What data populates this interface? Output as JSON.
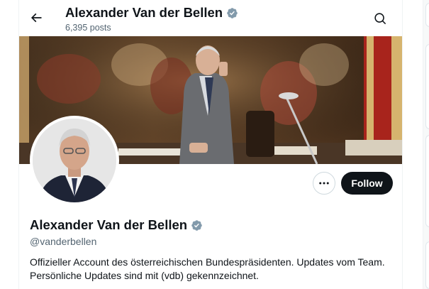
{
  "header": {
    "name": "Alexander Van der Bellen",
    "posts": "6,395 posts",
    "back_icon": "arrow-left-icon",
    "search_icon": "search-icon"
  },
  "profile": {
    "name": "Alexander Van der Bellen",
    "handle": "@vanderbellen",
    "bio_line1": "Offizieller Account des österreichischen Bundespräsidenten. Updates vom Team.",
    "bio_line2": "Persönliche Updates sind mit (vdb) gekennzeichnet.",
    "verified_badge": "verified-badge-icon",
    "badge_color": "#829aab"
  },
  "actions": {
    "more_icon": "more-options-icon",
    "follow_label": "Follow"
  },
  "colors": {
    "text": "#0f1419",
    "muted": "#536471",
    "button_bg": "#0f1419",
    "border": "#cfd9de"
  }
}
